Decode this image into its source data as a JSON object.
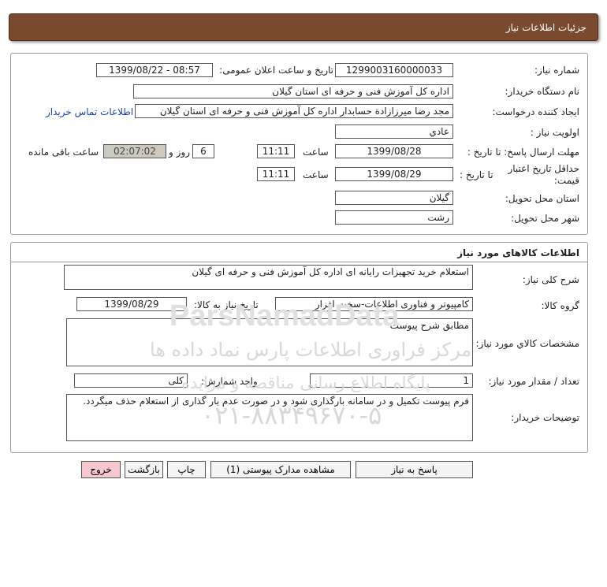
{
  "header": {
    "title": "جزئیات اطلاعات نیاز"
  },
  "form": {
    "need_number_label": "شماره نیاز:",
    "need_number": "1299003160000033",
    "announce_label": "تاریخ و ساعت اعلان عمومی:",
    "announce_value": "1399/08/22 - 08:57",
    "buyer_org_label": "نام دستگاه خریدار:",
    "buyer_org": "اداره کل آموزش فنی و حرفه ای استان گیلان",
    "requester_label": "ایجاد کننده درخواست:",
    "requester": "مجد رضا میرزازادة حسابدار اداره کل آموزش فنی و حرفه ای استان گیلان",
    "contact_link": "اطلاعات تماس خریدار",
    "priority_label": "اولویت نیاز :",
    "priority": "عادي",
    "deadline_label": "مهلت ارسال پاسخ: تا تاریخ :",
    "deadline_date": "1399/08/28",
    "time_label": "ساعت",
    "deadline_time": "11:11",
    "days_value": "6",
    "days_label": "روز و",
    "remaining_time": "02:07:02",
    "remaining_label": "ساعت باقی مانده",
    "validity_label": "حداقل تاریخ اعتبار قیمت:",
    "validity_date_label": "تا تاریخ :",
    "validity_date": "1399/08/29",
    "validity_time_label": "ساعت",
    "validity_time": "11:11",
    "province_label": "استان محل تحویل:",
    "province": "گیلان",
    "city_label": "شهر محل تحویل:",
    "city": "رشت"
  },
  "goods": {
    "section_title": "اطلاعات کالاهای مورد نیاز",
    "general_desc_label": "شرح کلی نیاز:",
    "general_desc": "استعلام خرید تجهیزات رایانه ای اداره کل آموزش فنی و حرفه ای گیلان",
    "group_label": "گروه کالا:",
    "group": "کامپیوتر و فناوری اطلاعات-سخت افزار",
    "need_date_label": "تاریخ نیاز به کالا:",
    "need_date": "1399/08/29",
    "specs_label": "مشخصات کالاي مورد نیاز:",
    "specs": "مطابق شرح پیوست",
    "qty_label": "تعداد / مقدار مورد نیاز:",
    "qty": "1",
    "unit_label": "واحد شمارش:",
    "unit": "کلی",
    "buyer_notes_label": "توضیحات خریدار:",
    "buyer_notes": "فرم پیوست تکمیل و در سامانه بارگذاری شود و در صورت عدم بار گذاری از استعلام حذف میگردد."
  },
  "buttons": {
    "respond": "پاسخ به نیاز",
    "attachments": "مشاهده مدارک پیوستی (1)",
    "print": "چاپ",
    "back": "بازگشت",
    "exit": "خروج"
  },
  "watermark": {
    "brand": "ParsNamadData",
    "line1": "مرکز فراوری اطلاعات پارس نماد داده ها",
    "line2": "پایگاه اطلاع رسانی مناقصه و مزایده",
    "phone": "۰۲۱-۸۸۳۴۹۶۷۰-۵"
  },
  "colors": {
    "title_bar": "#7a4a2e",
    "link": "#1a3fa8",
    "exit_button": "#f7c8ce",
    "remaining_box": "#ccc9bf"
  }
}
